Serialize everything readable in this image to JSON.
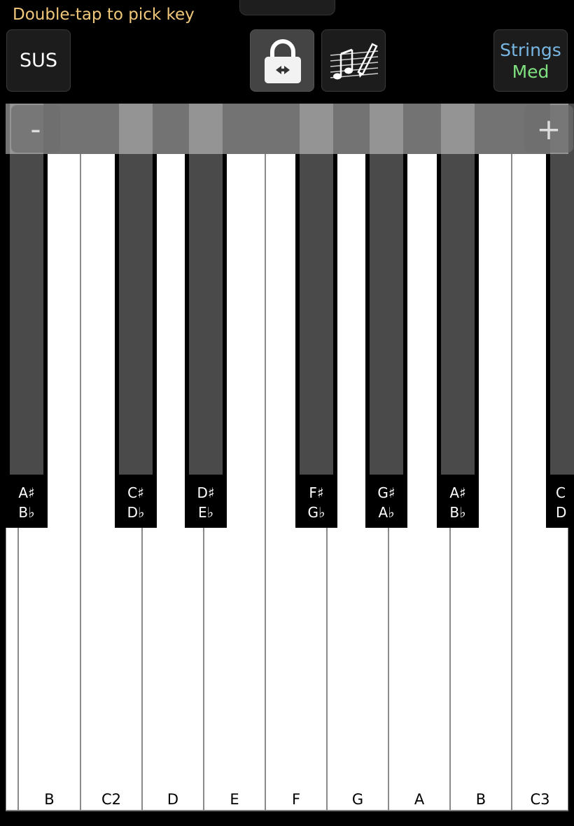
{
  "header": {
    "hint": "Double-tap to pick key",
    "sus_label": "SUS",
    "lock_icon": "lock-swap-icon",
    "notes_icon": "music-score-pencil-icon",
    "instrument_name": "Strings",
    "instrument_level": "Med"
  },
  "zoom": {
    "minus_label": "-",
    "plus_label": "+"
  },
  "white_keys": [
    "B",
    "C2",
    "D",
    "E",
    "F",
    "G",
    "A",
    "B",
    "C3"
  ],
  "black_keys": [
    {
      "sharp": "A♯",
      "flat": "B♭"
    },
    {
      "sharp": "C♯",
      "flat": "D♭"
    },
    {
      "sharp": "D♯",
      "flat": "E♭"
    },
    {
      "sharp": "F♯",
      "flat": "G♭"
    },
    {
      "sharp": "G♯",
      "flat": "A♭"
    },
    {
      "sharp": "A♯",
      "flat": "B♭"
    },
    {
      "sharp": "C",
      "flat": "D"
    }
  ],
  "colors": {
    "hint": "#f0c87a",
    "instrument_name": "#78b7e3",
    "instrument_level": "#7ee07e",
    "black_key_face": "#4a4a4a"
  }
}
